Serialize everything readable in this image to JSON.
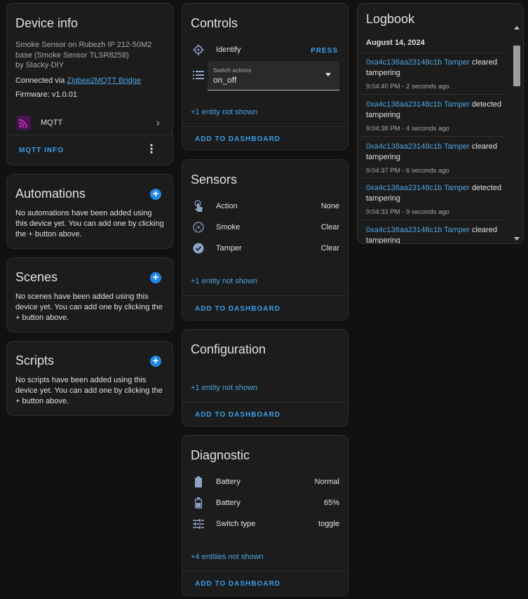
{
  "device_info": {
    "title": "Device info",
    "model": "Smoke Sensor on Rubezh IP 212-50M2 base (Smoke Sensor TLSR8258)",
    "manufacturer": "by Slacky-DIY",
    "connected_prefix": "Connected via",
    "connected_link": "Zigbee2MQTT Bridge",
    "firmware": "Firmware: v1.0.01",
    "integration_label": "MQTT",
    "action": "MQTT INFO"
  },
  "automations": {
    "title": "Automations",
    "text": "No automations have been added using this device yet. You can add one by clicking the + button above."
  },
  "scenes": {
    "title": "Scenes",
    "text": "No scenes have been added using this device yet. You can add one by clicking the + button above."
  },
  "scripts": {
    "title": "Scripts",
    "text": "No scripts have been added using this device yet. You can add one by clicking the + button above."
  },
  "controls": {
    "title": "Controls",
    "identify_label": "Identify",
    "identify_action": "PRESS",
    "select_label": "Switch actions",
    "select_value": "on_off",
    "hidden": "+1 entity not shown",
    "add": "ADD TO DASHBOARD"
  },
  "sensors": {
    "title": "Sensors",
    "rows": [
      {
        "name": "Action",
        "value": "None",
        "icon": "gesture-tap-icon"
      },
      {
        "name": "Smoke",
        "value": "Clear",
        "icon": "smoke-detector-icon"
      },
      {
        "name": "Tamper",
        "value": "Clear",
        "icon": "check-circle-icon"
      }
    ],
    "hidden": "+1 entity not shown",
    "add": "ADD TO DASHBOARD"
  },
  "configuration": {
    "title": "Configuration",
    "hidden": "+1 entity not shown",
    "add": "ADD TO DASHBOARD"
  },
  "diagnostic": {
    "title": "Diagnostic",
    "rows": [
      {
        "name": "Battery",
        "value": "Normal",
        "icon": "battery-icon"
      },
      {
        "name": "Battery",
        "value": "65%",
        "icon": "battery-60-icon"
      },
      {
        "name": "Switch type",
        "value": "toggle",
        "icon": "tune-icon"
      }
    ],
    "hidden": "+4 entities not shown",
    "add": "ADD TO DASHBOARD"
  },
  "logbook": {
    "title": "Logbook",
    "date": "August 14, 2024",
    "entries": [
      {
        "entity": "0xa4c138aa23148c1b Tamper",
        "action": "cleared",
        "state": "tampering",
        "time": "9:04:40 PM - 2 seconds ago"
      },
      {
        "entity": "0xa4c138aa23148c1b Tamper",
        "action": "detected",
        "state": "tampering",
        "time": "9:04:38 PM - 4 seconds ago"
      },
      {
        "entity": "0xa4c138aa23148c1b Tamper",
        "action": "cleared",
        "state": "tampering",
        "time": "9:04:37 PM - 6 seconds ago"
      },
      {
        "entity": "0xa4c138aa23148c1b Tamper",
        "action": "detected",
        "state": "tampering",
        "time": "9:04:33 PM - 9 seconds ago"
      },
      {
        "entity": "0xa4c138aa23148c1b Tamper",
        "action": "cleared",
        "state": "tampering",
        "time": ""
      }
    ]
  }
}
